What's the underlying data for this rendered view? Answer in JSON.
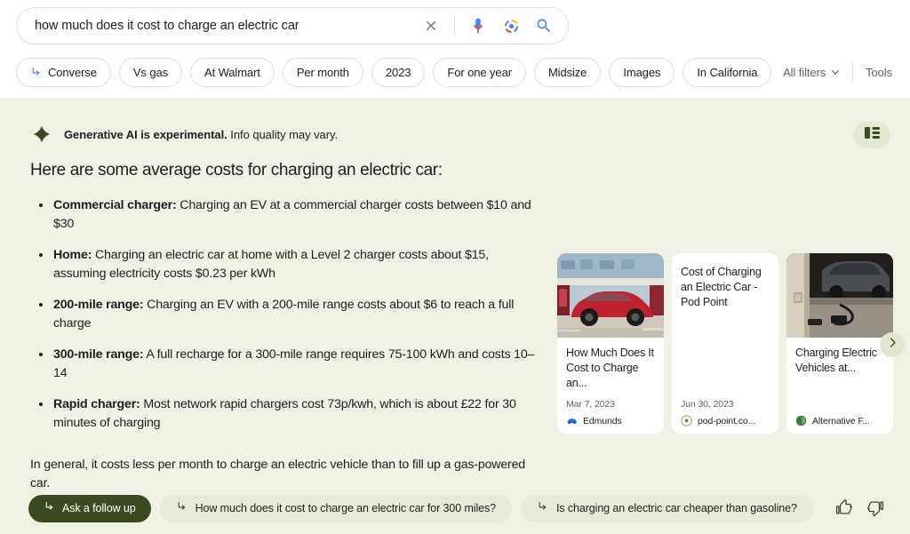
{
  "search": {
    "query": "how much does it cost to charge an electric car",
    "placeholder": "Search",
    "icons": {
      "clear": "close-icon",
      "voice": "microphone-icon",
      "lens": "google-lens-icon",
      "search": "search-icon"
    }
  },
  "chips": [
    {
      "label": "Converse",
      "has_arrow": true
    },
    {
      "label": "Vs gas",
      "has_arrow": false
    },
    {
      "label": "At Walmart",
      "has_arrow": false
    },
    {
      "label": "Per month",
      "has_arrow": false
    },
    {
      "label": "2023",
      "has_arrow": false
    },
    {
      "label": "For one year",
      "has_arrow": false
    },
    {
      "label": "Midsize",
      "has_arrow": false
    },
    {
      "label": "Images",
      "has_arrow": false
    },
    {
      "label": "In California",
      "has_arrow": false
    }
  ],
  "filters": {
    "all_filters_label": "All filters",
    "tools_label": "Tools"
  },
  "ai_panel": {
    "background_color": "#eef1e3",
    "disclaimer_bold": "Generative AI is experimental.",
    "disclaimer_rest": " Info quality may vary.",
    "spark_icon": "sparkle-icon",
    "view_toggle_icon": "layout-toggle-icon",
    "heading": "Here are some average costs for charging an electric car:",
    "bullets": [
      {
        "label": "Commercial charger:",
        "text": " Charging an EV at a commercial charger costs between $10 and $30"
      },
      {
        "label": "Home:",
        "text": " Charging an electric car at home with a Level 2 charger costs about $15, assuming electricity costs $0.23 per kWh"
      },
      {
        "label": "200-mile range:",
        "text": " Charging an EV with a 200-mile range costs about $6 to reach a full charge"
      },
      {
        "label": "300-mile range:",
        "text": " A full recharge for a 300-mile range requires 75-100 kWh and costs 10–14"
      },
      {
        "label": "Rapid charger:",
        "text": " Most network rapid chargers cost 73p/kwh, which is about £22 for 30 minutes of charging"
      }
    ],
    "summary": "In general, it costs less per month to charge an electric vehicle than to fill up a gas-powered car."
  },
  "cards": [
    {
      "title": "How Much Does It Cost to Charge an...",
      "date": "Mar 7, 2023",
      "source": "Edmunds",
      "favicon_color": "#1a73e8",
      "has_image": true,
      "image_alt": "red-tesla-at-charging-station"
    },
    {
      "title": "Cost of Charging an Electric Car - Pod Point",
      "date": "Jun 30, 2023",
      "source": "pod-point.co...",
      "favicon_color": "#7d8c3f",
      "has_image": false,
      "image_alt": ""
    },
    {
      "title": "Charging Electric Vehicles at...",
      "date": "",
      "source": "Alternative F...",
      "favicon_color": "#3f7d3f",
      "has_image": true,
      "image_alt": "car-charging-in-garage"
    }
  ],
  "carousel": {
    "next_label": "next-arrow-icon"
  },
  "bottom": {
    "followup_label": "Ask a follow up",
    "suggestions": [
      "How much does it cost to charge an electric car for 300 miles?",
      "Is charging an electric car cheaper than gasoline?"
    ],
    "thumbs_up": "thumbs-up-icon",
    "thumbs_down": "thumbs-down-icon"
  }
}
